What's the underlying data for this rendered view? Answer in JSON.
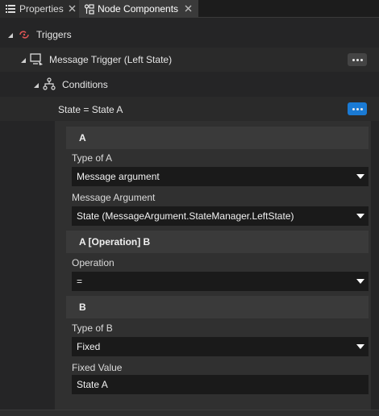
{
  "tabs": [
    {
      "label": "Properties",
      "icon": "list-icon",
      "active": false
    },
    {
      "label": "Node Components",
      "icon": "node-components-icon",
      "active": true
    }
  ],
  "tree": {
    "triggers": {
      "label": "Triggers",
      "icon": "trigger-icon"
    },
    "message_trigger": {
      "label": "Message Trigger (Left State)",
      "icon": "message-trigger-icon"
    },
    "conditions": {
      "label": "Conditions",
      "icon": "conditions-hierarchy-icon"
    },
    "condition": {
      "label": "State = State A"
    }
  },
  "condition_editor": {
    "section_a": {
      "title": "A"
    },
    "type_of_a": {
      "label": "Type of A",
      "value": "Message argument"
    },
    "message_argument": {
      "label": "Message Argument",
      "value": "State (MessageArgument.StateManager.LeftState)"
    },
    "section_op": {
      "title": "A [Operation] B"
    },
    "operation": {
      "label": "Operation",
      "value": "="
    },
    "section_b": {
      "title": "B"
    },
    "type_of_b": {
      "label": "Type of B",
      "value": "Fixed"
    },
    "fixed_value": {
      "label": "Fixed Value",
      "value": "State A"
    }
  },
  "colors": {
    "accent": "#1a7ad4",
    "trigger_icon": "#e05555"
  }
}
